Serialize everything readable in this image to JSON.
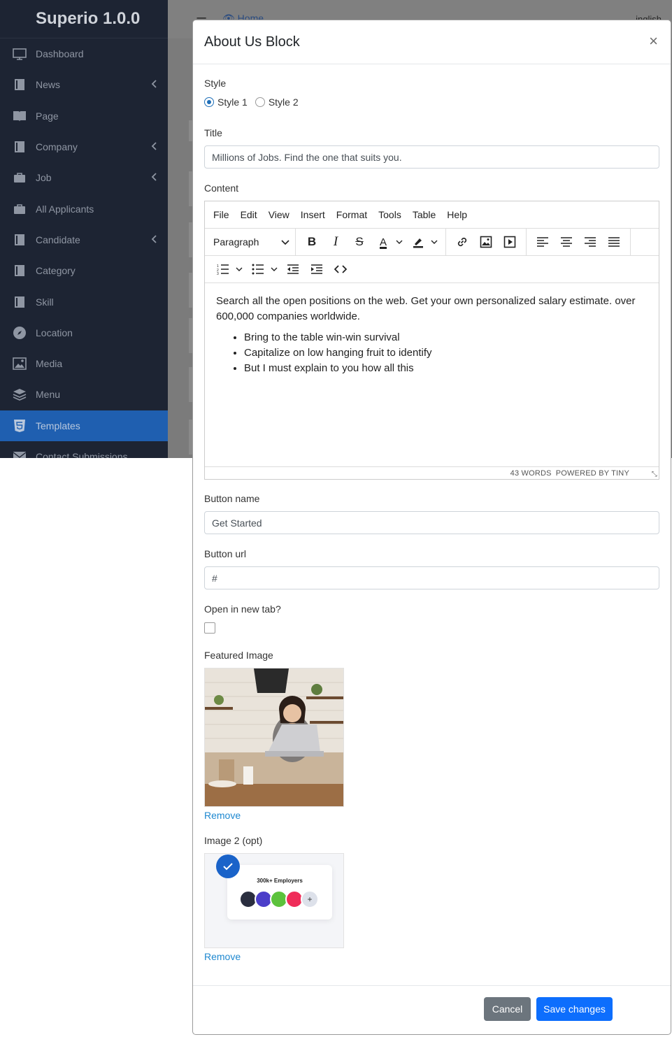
{
  "app": {
    "brand": "Superio 1.0.0",
    "topbar": {
      "breadcrumb": "Home",
      "language": "inglish"
    },
    "sidebar": {
      "items": [
        {
          "label": "Dashboard",
          "icon": "monitor-icon",
          "chevron": false,
          "active": false
        },
        {
          "label": "News",
          "icon": "book-icon",
          "chevron": true,
          "active": false
        },
        {
          "label": "Page",
          "icon": "book-open-icon",
          "chevron": false,
          "active": false
        },
        {
          "label": "Company",
          "icon": "book-icon",
          "chevron": true,
          "active": false
        },
        {
          "label": "Job",
          "icon": "briefcase-icon",
          "chevron": true,
          "active": false
        },
        {
          "label": "All Applicants",
          "icon": "briefcase-icon",
          "chevron": false,
          "active": false
        },
        {
          "label": "Candidate",
          "icon": "book-icon",
          "chevron": true,
          "active": false
        },
        {
          "label": "Category",
          "icon": "book-icon",
          "chevron": false,
          "active": false
        },
        {
          "label": "Skill",
          "icon": "book-icon",
          "chevron": false,
          "active": false
        },
        {
          "label": "Location",
          "icon": "compass-icon",
          "chevron": false,
          "active": false
        },
        {
          "label": "Media",
          "icon": "image-icon",
          "chevron": false,
          "active": false
        },
        {
          "label": "Menu",
          "icon": "layers-icon",
          "chevron": false,
          "active": false
        },
        {
          "label": "Templates",
          "icon": "html5-icon",
          "chevron": false,
          "active": true
        },
        {
          "label": "Contact Submissions",
          "icon": "mail-icon",
          "chevron": false,
          "active": false
        }
      ]
    }
  },
  "modal": {
    "title": "About Us Block",
    "close": "×",
    "style": {
      "label": "Style",
      "options": [
        "Style 1",
        "Style 2"
      ],
      "selected": "Style 1"
    },
    "title_field": {
      "label": "Title",
      "value": "Millions of Jobs. Find the one that suits you."
    },
    "content": {
      "label": "Content",
      "menu": [
        "File",
        "Edit",
        "View",
        "Insert",
        "Format",
        "Tools",
        "Table",
        "Help"
      ],
      "block_format": "Paragraph",
      "paragraph": "Search all the open positions on the web. Get your own personalized salary estimate. over 600,000 companies worldwide.",
      "bullets": [
        "Bring to the table win-win survival",
        "Capitalize on low hanging fruit to identify",
        "But I must explain to you how all this"
      ],
      "word_count": "43 WORDS",
      "powered_by": "POWERED BY TINY"
    },
    "button_name": {
      "label": "Button name",
      "value": "Get Started"
    },
    "button_url": {
      "label": "Button url",
      "value": "#"
    },
    "new_tab": {
      "label": "Open in new tab?",
      "checked": false
    },
    "featured_image": {
      "label": "Featured Image",
      "remove": "Remove"
    },
    "image2": {
      "label": "Image 2 (opt)",
      "remove": "Remove",
      "caption": "300k+ Employers"
    },
    "footer": {
      "cancel": "Cancel",
      "save": "Save changes"
    }
  },
  "colors": {
    "sidebar_bg": "#1d2433",
    "active_item": "#1f5fb0",
    "primary": "#0d6efd",
    "secondary": "#6c757d",
    "link": "#1e88d0"
  }
}
